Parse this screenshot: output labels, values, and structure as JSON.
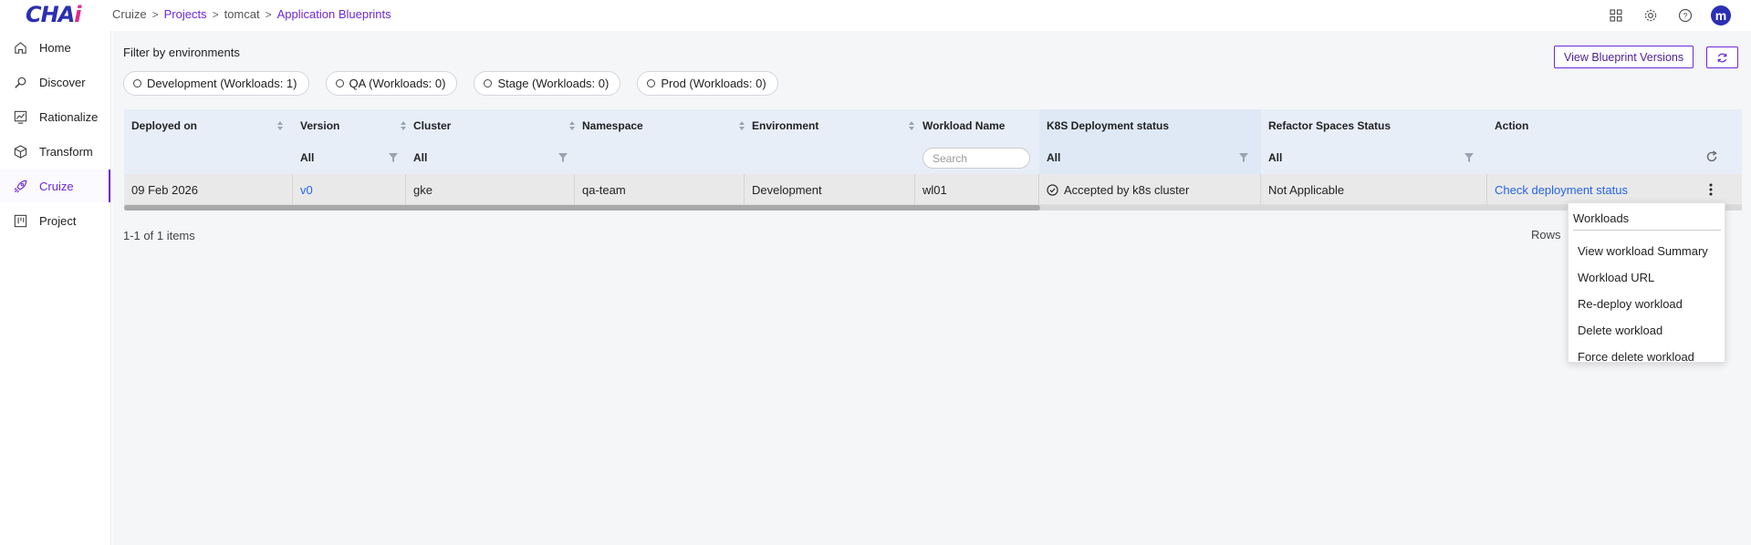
{
  "app": {
    "logo_main": "CHA",
    "logo_accent": "i"
  },
  "breadcrumb": [
    "Cruize",
    "Projects",
    "tomcat",
    "Application Blueprints"
  ],
  "user": {
    "initial": "m"
  },
  "sidebar": {
    "items": [
      {
        "label": "Home",
        "icon": "home-icon"
      },
      {
        "label": "Discover",
        "icon": "discover-icon"
      },
      {
        "label": "Rationalize",
        "icon": "rationalize-icon"
      },
      {
        "label": "Transform",
        "icon": "cube-icon"
      },
      {
        "label": "Cruize",
        "icon": "rocket-icon",
        "active": true
      },
      {
        "label": "Project",
        "icon": "project-icon"
      }
    ]
  },
  "filters": {
    "title": "Filter by environments",
    "chips": [
      "Development (Workloads: 1)",
      "QA (Workloads: 0)",
      "Stage (Workloads: 0)",
      "Prod (Workloads: 0)"
    ]
  },
  "toolbar": {
    "view_versions_label": "View Blueprint Versions"
  },
  "table": {
    "columns": [
      "Deployed on",
      "Version",
      "Cluster",
      "Namespace",
      "Environment",
      "Workload Name",
      "K8S Deployment status",
      "Refactor Spaces Status",
      "Action"
    ],
    "filters": {
      "version": "All",
      "cluster": "All",
      "workload_search_placeholder": "Search",
      "k8s_status": "All",
      "refactor_status": "All"
    },
    "rows": [
      {
        "deployed_on": "09 Feb 2026",
        "version": "v0",
        "cluster": "gke",
        "namespace": "qa-team",
        "environment": "Development",
        "workload_name": "wl01",
        "k8s_status": "Accepted by k8s cluster",
        "refactor_status": "Not Applicable",
        "action": "Check deployment status"
      }
    ]
  },
  "pagination": {
    "info": "1-1 of 1 items",
    "rows_label": "Rows"
  },
  "menu": {
    "header": "Workloads",
    "items": [
      "View workload Summary",
      "Workload URL",
      "Re-deploy workload",
      "Delete workload",
      "Force delete workload"
    ]
  },
  "colors": {
    "accent": "#6d28d9",
    "link": "#2563eb",
    "brand": "#2b2fb3"
  }
}
